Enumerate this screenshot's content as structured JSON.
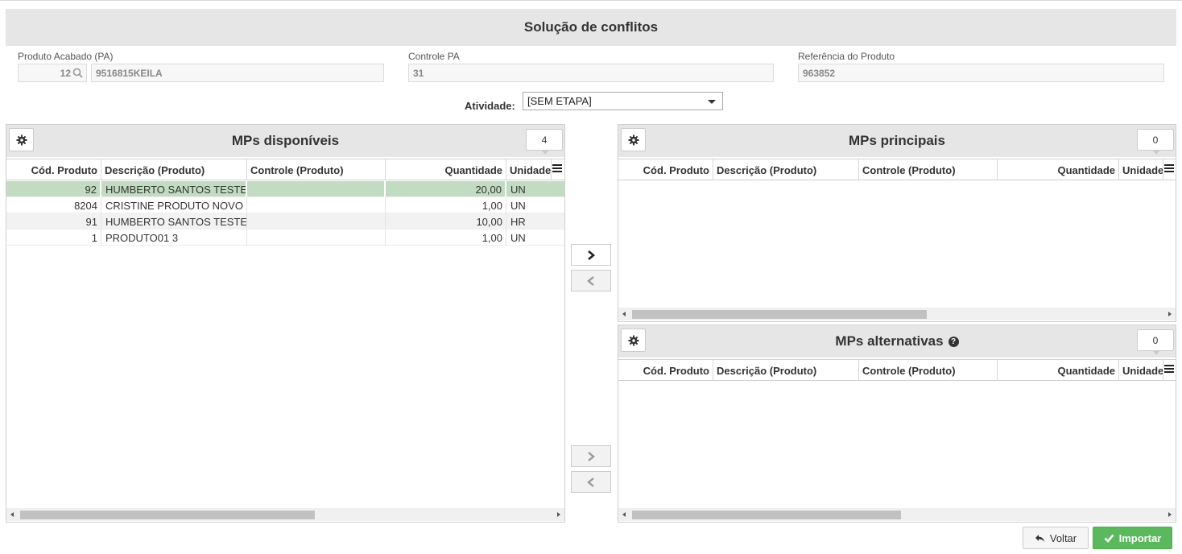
{
  "page": {
    "title": "Solução de conflitos"
  },
  "header": {
    "pa": {
      "label": "Produto Acabado (PA)",
      "code": "12",
      "name": "9516815KEILA"
    },
    "controle": {
      "label": "Controle PA",
      "value": "31"
    },
    "referencia": {
      "label": "Referência do Produto",
      "value": "963852"
    }
  },
  "activity": {
    "label": "Atividade:",
    "selected": "[SEM ETAPA]"
  },
  "columns": {
    "cod": "Cód. Produto",
    "desc": "Descrição (Produto)",
    "ctrl": "Controle (Produto)",
    "qtd": "Quantidade",
    "un": "Unidade"
  },
  "available": {
    "title": "MPs disponíveis",
    "count": "4",
    "rows": [
      {
        "cod": "92",
        "desc": "HUMBERTO SANTOS TESTE",
        "ctrl": "",
        "qtd": "20,00",
        "un": "UN"
      },
      {
        "cod": "8204",
        "desc": "CRISTINE PRODUTO NOVO",
        "ctrl": "",
        "qtd": "1,00",
        "un": "UN"
      },
      {
        "cod": "91",
        "desc": "HUMBERTO SANTOS TESTE",
        "ctrl": "",
        "qtd": "10,00",
        "un": "HR"
      },
      {
        "cod": "1",
        "desc": "PRODUTO01 3",
        "ctrl": "",
        "qtd": "1,00",
        "un": "UN"
      }
    ]
  },
  "principal": {
    "title": "MPs principais",
    "count": "0"
  },
  "alternative": {
    "title": "MPs alternativas",
    "count": "0"
  },
  "buttons": {
    "back": "Voltar",
    "import": "Importar"
  },
  "colors": {
    "selected_row": "#c2dcc2",
    "import_button": "#5cb85c"
  }
}
